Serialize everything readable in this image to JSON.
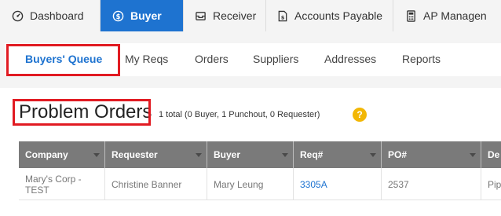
{
  "topnav": {
    "tabs": [
      {
        "label": "Dashboard",
        "icon": "dashboard-icon"
      },
      {
        "label": "Buyer",
        "icon": "dollar-circle-icon",
        "active": true
      },
      {
        "label": "Receiver",
        "icon": "inbox-icon"
      },
      {
        "label": "Accounts Payable",
        "icon": "invoice-icon"
      },
      {
        "label": "AP Managen",
        "icon": "calculator-icon"
      }
    ]
  },
  "subnav": {
    "items": [
      "Buyers' Queue",
      "My Reqs",
      "Orders",
      "Suppliers",
      "Addresses",
      "Reports"
    ]
  },
  "section": {
    "title": "Problem Orders",
    "summary": "1 total (0 Buyer, 1 Punchout, 0 Requester)",
    "help": "?"
  },
  "table": {
    "columns": [
      "Company",
      "Requester",
      "Buyer",
      "Req#",
      "PO#",
      "De"
    ],
    "rows": [
      [
        "Mary's Corp - TEST",
        "Christine Banner",
        "Mary Leung",
        "3305A",
        "2537",
        "Pip"
      ]
    ]
  },
  "colors": {
    "accent": "#1e73d0",
    "highlight_box": "#e11b22",
    "table_header": "#7a7a7a",
    "help_badge": "#f2b705"
  }
}
